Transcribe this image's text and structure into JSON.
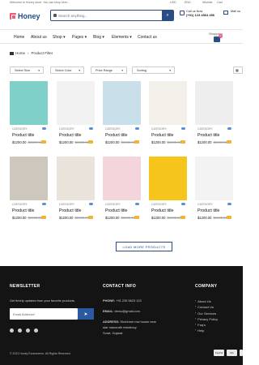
{
  "topbar": {
    "welcome": "Welcome to Honey store. You can shop here...",
    "currency": "USD",
    "language": "ENG",
    "wishlist": "Wishlist",
    "cart": "Cart"
  },
  "header": {
    "logo": "Honey",
    "search_placeholder": "Search anything...",
    "call_label": "Call us Now",
    "call_number": "(+91) 123 4564 456",
    "mail_label": "Mail us"
  },
  "nav": {
    "items": [
      "Home",
      "About us",
      "Shop ▾",
      "Pages ▾",
      "Blog ▾",
      "Elements ▾",
      "Contact us"
    ],
    "shopping_label": "Shopping",
    "cart_count": "0"
  },
  "breadcrumb": {
    "home": "Home",
    "sep": "›",
    "current": "Product Filter"
  },
  "filters": {
    "size": "Select Size",
    "color": "Select Color",
    "price": "Price Range",
    "sorting": "Sorting"
  },
  "products": [
    {
      "category": "CATEGORY",
      "title": "Product title",
      "price": "$1200.00",
      "old_price": "$1500.00",
      "bg": "#7fd0c8",
      "icon": "watch-image"
    },
    {
      "category": "CATEGORY",
      "title": "Product title",
      "price": "$1200.00",
      "old_price": "$1500.00",
      "bg": "#f2f2f2",
      "icon": "bicycle-image"
    },
    {
      "category": "CATEGORY",
      "title": "Product title",
      "price": "$1200.00",
      "old_price": "$1500.00",
      "bg": "#c9dfea",
      "icon": "jar-image"
    },
    {
      "category": "CATEGORY",
      "title": "Product title",
      "price": "$1200.00",
      "old_price": "$1500.00",
      "bg": "#f3efe9",
      "icon": "cosmetics-image"
    },
    {
      "category": "CATEGORY",
      "title": "Product title",
      "price": "$1200.00",
      "old_price": "$1500.00",
      "bg": "#eeeeee",
      "icon": "cream-jar-image"
    },
    {
      "category": "CATEGORY",
      "title": "Product title",
      "price": "$1200.00",
      "old_price": "$1500.00",
      "bg": "#cdc7bd",
      "icon": "sneaker-image"
    },
    {
      "category": "CATEGORY",
      "title": "Product title",
      "price": "$1200.00",
      "old_price": "$1500.00",
      "bg": "#e9e3dc",
      "icon": "loafers-image"
    },
    {
      "category": "CATEGORY",
      "title": "Product title",
      "price": "$1200.00",
      "old_price": "$1500.00",
      "bg": "#f4d5dc",
      "icon": "tube-image"
    },
    {
      "category": "CATEGORY",
      "title": "Product title",
      "price": "$1200.00",
      "old_price": "$1500.00",
      "bg": "#f6c51c",
      "icon": "box-image"
    },
    {
      "category": "CATEGORY",
      "title": "Product title",
      "price": "$1200.00",
      "old_price": "$1500.00",
      "bg": "#f3f3f3",
      "icon": "makeup-set-image"
    }
  ],
  "load_more": "LOAD MORE PRODUCTS",
  "footer": {
    "newsletter_title": "NEWSLETTER",
    "newsletter_text": "Get timely updates from your favorite products.",
    "email_placeholder": "Email Address*",
    "contact_title": "CONTACT INFO",
    "phone_label": "PHONE:",
    "phone": "+91 235 5623 123",
    "email_label": "EMAIL:",
    "email": "demo@gmail.com",
    "address_label": "ADDRESS:",
    "address_line1": "Shubham row house near",
    "address_line2": "star manorath residency",
    "address_line3": "Surat, Gujarat.",
    "company_title": "COMPANY",
    "company_links": [
      "About Us",
      "Contact Us",
      "Our Services",
      "Privacy Policy",
      "Faq's",
      "Help"
    ],
    "copyright": "© 2021 Honey Ecommerce, All Rights Reserved.",
    "payments": [
      "PayPal",
      "MC",
      "VISA"
    ]
  },
  "colors": {
    "brand_blue": "#2b4d86",
    "accent_pink": "#ef5a76",
    "footer_bg": "#141414"
  }
}
